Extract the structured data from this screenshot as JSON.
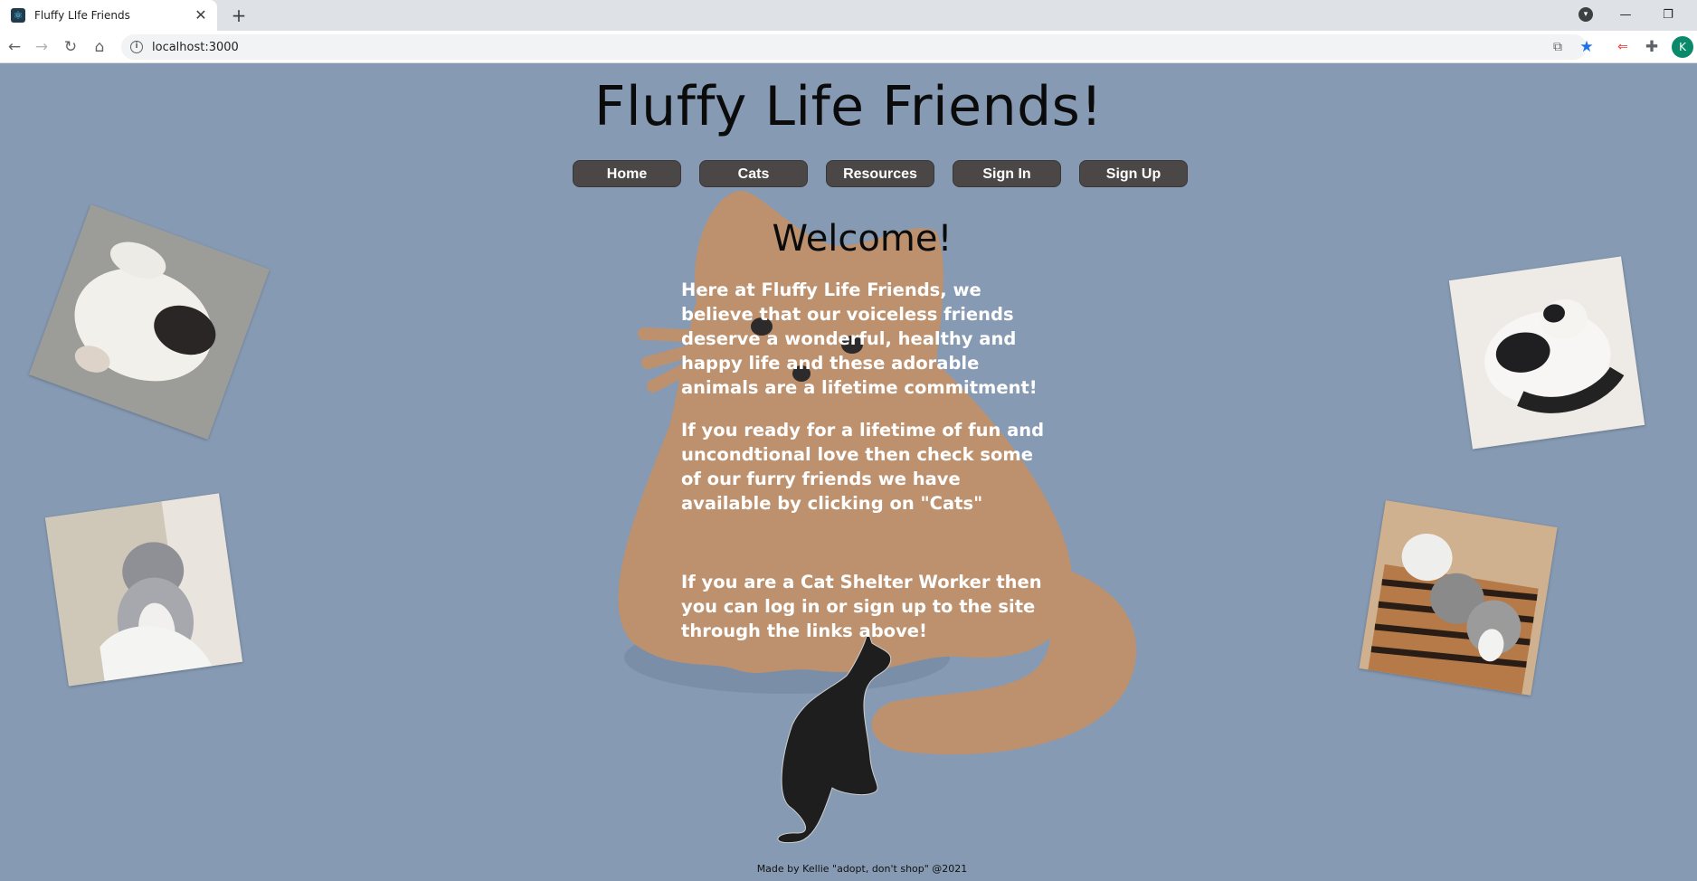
{
  "browser": {
    "tab_title": "Fluffy LIfe Friends",
    "tab_close": "✕",
    "new_tab": "+",
    "url": "localhost:3000",
    "avatar_letter": "K",
    "controls": {
      "minimize": "—",
      "restore": "❐"
    }
  },
  "icons": {
    "favicon": "react-icon",
    "back": "back-arrow-icon",
    "forward": "forward-arrow-icon",
    "reload": "reload-icon",
    "home": "home-icon",
    "info": "info-icon",
    "open_in": "open-in-icon",
    "bookmark": "star-icon",
    "extension_1": "extension-icon",
    "extensions": "puzzle-icon"
  },
  "site": {
    "title": "Fluffy Life Friends!",
    "nav": [
      {
        "label": "Home"
      },
      {
        "label": "Cats"
      },
      {
        "label": "Resources"
      },
      {
        "label": "Sign In"
      },
      {
        "label": "Sign Up"
      }
    ],
    "welcome": "Welcome!",
    "paragraphs": [
      "Here at Fluffy Life Friends, we believe that our voiceless friends deserve a wonderful, healthy and happy life and these adorable animals are a lifetime commitment!",
      "If you ready for a lifetime of fun and uncondtional love then check some of our furry friends we have available by clicking on \"Cats\"",
      "If you are a Cat Shelter Worker then you can log in or sign up to the site through the links above!"
    ],
    "footer": "Made by Kellie \"adopt, don't shop\" @2021"
  },
  "colors": {
    "page_background": "#869ab3",
    "nav_button": "#4b4747",
    "cat_art_orange": "#bd916e",
    "cat_silhouette": "#1e1e1e",
    "text_white": "#ffffff"
  },
  "photos": [
    {
      "name": "photo-white-cat-playing",
      "subject": "white and black cat lying on its back"
    },
    {
      "name": "photo-grey-kitten",
      "subject": "grey and white kitten sitting"
    },
    {
      "name": "photo-fluffy-black-white-cat",
      "subject": "fluffy black and white cat lying down"
    },
    {
      "name": "photo-three-kittens",
      "subject": "three kittens on a striped cushion"
    }
  ]
}
